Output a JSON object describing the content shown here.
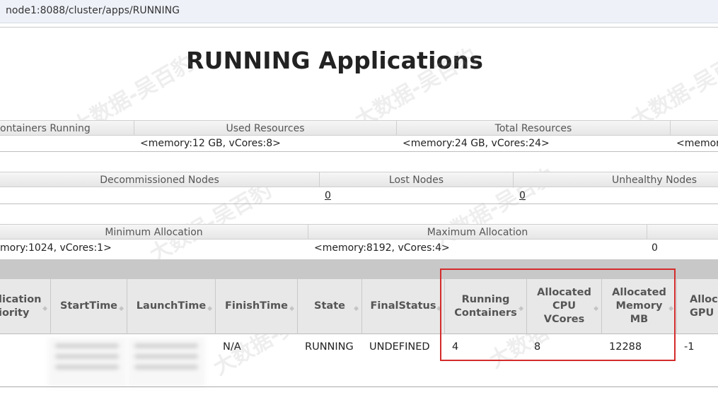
{
  "browser": {
    "url": "node1:8088/cluster/apps/RUNNING"
  },
  "page": {
    "title": "RUNNING Applications"
  },
  "metrics1": {
    "headers": [
      "ontainers Running",
      "Used Resources",
      "Total Resources"
    ],
    "values": [
      "<memory:12 GB, vCores:8>",
      "<memory:24 GB, vCores:24>",
      "<memor"
    ]
  },
  "metrics2": {
    "headers": [
      "Decommissioned Nodes",
      "Lost Nodes",
      "Unhealthy Nodes"
    ],
    "values": [
      "0",
      "0"
    ]
  },
  "metrics3": {
    "headers": [
      "Minimum Allocation",
      "Maximum Allocation"
    ],
    "values": [
      "mory:1024, vCores:1>",
      "<memory:8192, vCores:4>",
      "0"
    ]
  },
  "apps_table": {
    "columns": {
      "priority": "lication\niority",
      "start_time": "StartTime",
      "launch_time": "LaunchTime",
      "finish_time": "FinishTime",
      "state": "State",
      "final_status": "FinalStatus",
      "running_containers": "Running\nContainers",
      "alloc_vcores": "Allocated\nCPU\nVCores",
      "alloc_memory": "Allocated\nMemory\nMB",
      "alloc_gpu": "Alloca\nGPU"
    },
    "rows": [
      {
        "finish_time": "N/A",
        "state": "RUNNING",
        "final_status": "UNDEFINED",
        "running_containers": "4",
        "alloc_vcores": "8",
        "alloc_memory": "12288",
        "alloc_gpu": "-1"
      }
    ]
  },
  "colors": {
    "highlight": "#d42b2b",
    "header_bg": "#e8e8e8",
    "gray_bar": "#c8c8c8"
  },
  "watermark": "大数据-吴百豹",
  "icons": {
    "sort": "sort-arrows-icon"
  }
}
